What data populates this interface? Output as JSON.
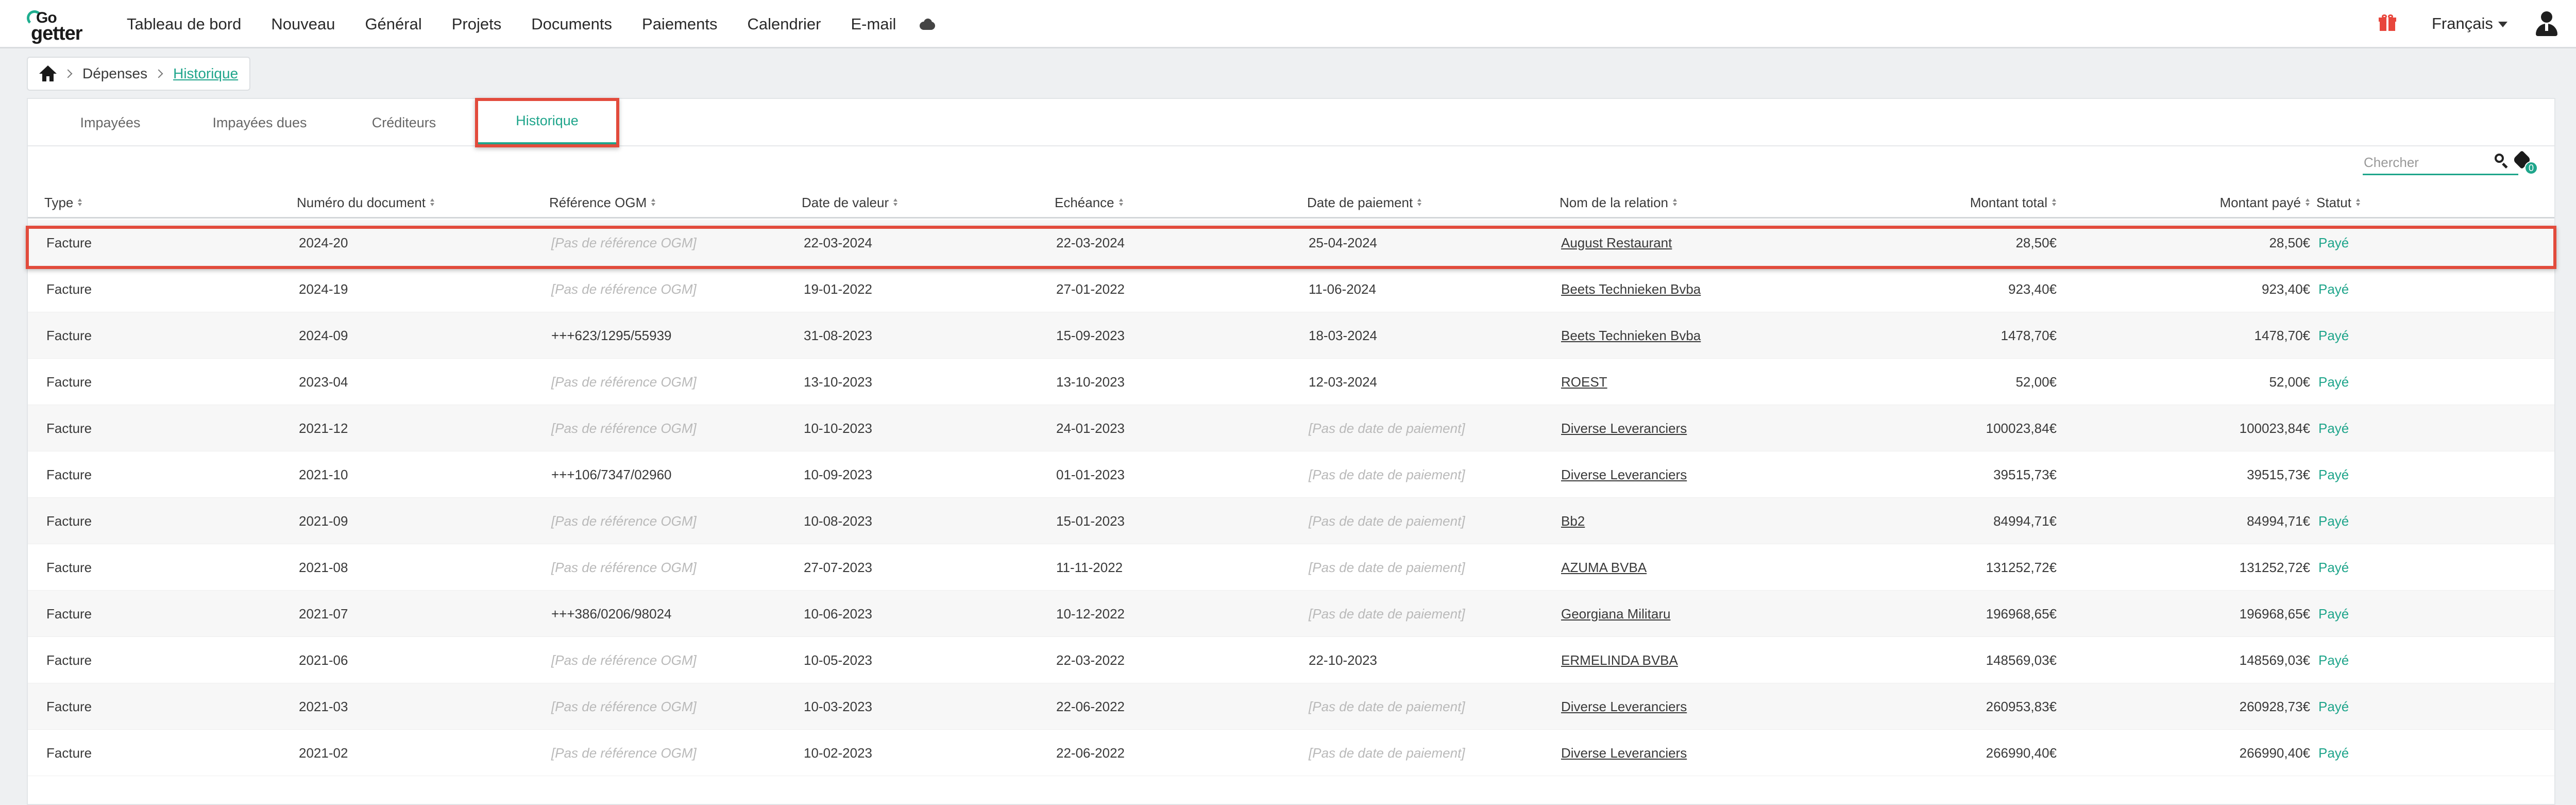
{
  "topnav": {
    "logo_text_top": "Go",
    "logo_text_bottom": "getter",
    "menu": [
      "Tableau de bord",
      "Nouveau",
      "Général",
      "Projets",
      "Documents",
      "Paiements",
      "Calendrier",
      "E-mail"
    ],
    "language": "Français",
    "icons": [
      "cloud-icon",
      "gift-icon",
      "user-icon"
    ]
  },
  "breadcrumb": {
    "items": [
      "Dépenses",
      "Historique"
    ]
  },
  "tabs": [
    "Impayées",
    "Impayées dues",
    "Créditeurs",
    "Historique"
  ],
  "active_tab": "Historique",
  "search": {
    "placeholder": "Chercher",
    "badge_count": "0"
  },
  "table": {
    "headers": [
      "Type",
      "Numéro du document",
      "Référence OGM",
      "Date de valeur",
      "Echéance",
      "Date de paiement",
      "Nom de la relation",
      "Montant total",
      "Montant payé",
      "Statut"
    ],
    "rows": [
      [
        "Facture",
        "2024-20",
        "[Pas de référence OGM]",
        "22-03-2024",
        "22-03-2024",
        "25-04-2024",
        "August Restaurant",
        "28,50€",
        "28,50€",
        "Payé"
      ],
      [
        "Facture",
        "2024-19",
        "[Pas de référence OGM]",
        "19-01-2022",
        "27-01-2022",
        "11-06-2024",
        "Beets Technieken Bvba",
        "923,40€",
        "923,40€",
        "Payé"
      ],
      [
        "Facture",
        "2024-09",
        "+++623/1295/55939",
        "31-08-2023",
        "15-09-2023",
        "18-03-2024",
        "Beets Technieken Bvba",
        "1478,70€",
        "1478,70€",
        "Payé"
      ],
      [
        "Facture",
        "2023-04",
        "[Pas de référence OGM]",
        "13-10-2023",
        "13-10-2023",
        "12-03-2024",
        "ROEST",
        "52,00€",
        "52,00€",
        "Payé"
      ],
      [
        "Facture",
        "2021-12",
        "[Pas de référence OGM]",
        "10-10-2023",
        "24-01-2023",
        "[Pas de date de paiement]",
        "Diverse Leveranciers",
        "100023,84€",
        "100023,84€",
        "Payé"
      ],
      [
        "Facture",
        "2021-10",
        "+++106/7347/02960",
        "10-09-2023",
        "01-01-2023",
        "[Pas de date de paiement]",
        "Diverse Leveranciers",
        "39515,73€",
        "39515,73€",
        "Payé"
      ],
      [
        "Facture",
        "2021-09",
        "[Pas de référence OGM]",
        "10-08-2023",
        "15-01-2023",
        "[Pas de date de paiement]",
        "Bb2",
        "84994,71€",
        "84994,71€",
        "Payé"
      ],
      [
        "Facture",
        "2021-08",
        "[Pas de référence OGM]",
        "27-07-2023",
        "11-11-2022",
        "[Pas de date de paiement]",
        "AZUMA BVBA",
        "131252,72€",
        "131252,72€",
        "Payé"
      ],
      [
        "Facture",
        "2021-07",
        "+++386/0206/98024",
        "10-06-2023",
        "10-12-2022",
        "[Pas de date de paiement]",
        "Georgiana Militaru",
        "196968,65€",
        "196968,65€",
        "Payé"
      ],
      [
        "Facture",
        "2021-06",
        "[Pas de référence OGM]",
        "10-05-2023",
        "22-03-2022",
        "22-10-2023",
        "ERMELINDA BVBA",
        "148569,03€",
        "148569,03€",
        "Payé"
      ],
      [
        "Facture",
        "2021-03",
        "[Pas de référence OGM]",
        "10-03-2023",
        "22-06-2022",
        "[Pas de date de paiement]",
        "Diverse Leveranciers",
        "260953,83€",
        "260928,73€",
        "Payé"
      ],
      [
        "Facture",
        "2021-02",
        "[Pas de référence OGM]",
        "10-02-2023",
        "22-06-2022",
        "[Pas de date de paiement]",
        "Diverse Leveranciers",
        "266990,40€",
        "266990,40€",
        "Payé"
      ]
    ]
  },
  "colors": {
    "accent": "#1fa58b",
    "highlight": "#e24b3c"
  }
}
